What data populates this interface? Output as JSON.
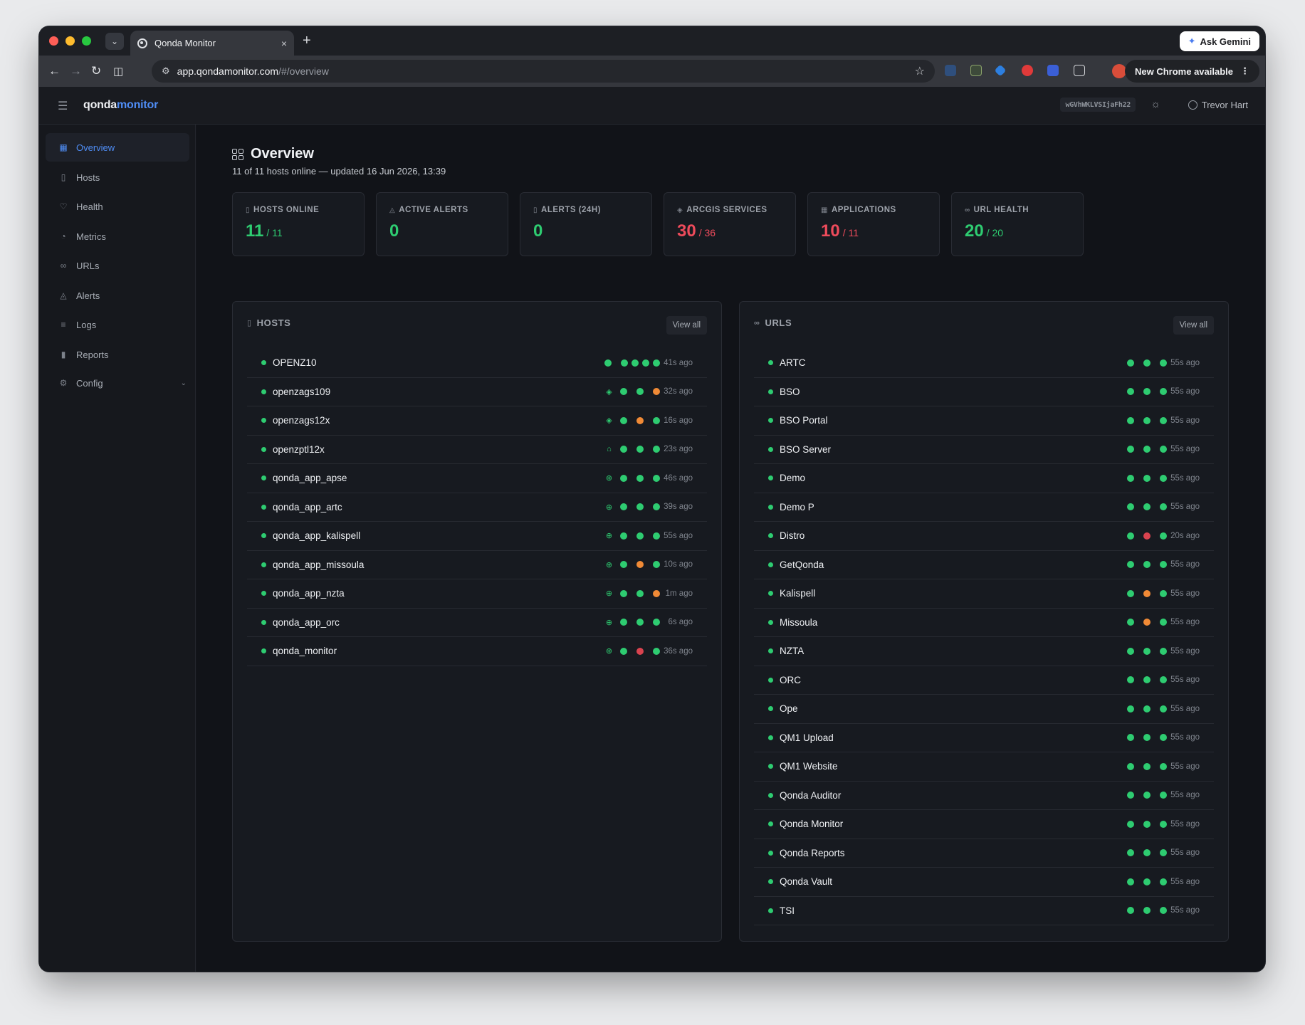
{
  "browser": {
    "tab_title": "Qonda Monitor",
    "tab_close": "×",
    "new_tab": "+",
    "url_host": "app.qondamonitor.com",
    "url_path": "/#/overview",
    "ask_gemini": "Ask Gemini",
    "new_chrome": "New Chrome available"
  },
  "app": {
    "brand_a": "qonda",
    "brand_b": "monitor",
    "token": "wGVhWKLVSIjaFh22",
    "user": "Trevor Hart"
  },
  "sidebar": {
    "items": [
      {
        "label": "Overview",
        "icon": "grid-icon",
        "active": true
      },
      {
        "label": "Hosts",
        "icon": "server-icon"
      },
      {
        "label": "Health",
        "icon": "heart-icon"
      },
      {
        "label": "Metrics",
        "icon": "gauge-icon"
      },
      {
        "label": "URLs",
        "icon": "link-icon"
      },
      {
        "label": "Alerts",
        "icon": "bell-icon"
      },
      {
        "label": "Logs",
        "icon": "list-icon"
      },
      {
        "label": "Reports",
        "icon": "bar-chart-icon"
      },
      {
        "label": "Config",
        "icon": "gear-icon"
      }
    ]
  },
  "page": {
    "title": "Overview",
    "subtitle": "11 of 11 hosts online — updated 16 Jun 2026, 13:39"
  },
  "stats": [
    {
      "label": "Hosts Online",
      "value": "11",
      "total": "/ 11",
      "color": "#2ecc71"
    },
    {
      "label": "Active Alerts",
      "value": "0",
      "total": "",
      "color": "#2ecc71"
    },
    {
      "label": "Alerts (24h)",
      "value": "0",
      "total": "",
      "color": "#2ecc71"
    },
    {
      "label": "ArcGIS Services",
      "value": "30",
      "total": "/ 36",
      "color": "#ee4b5b"
    },
    {
      "label": "Applications",
      "value": "10",
      "total": "/ 11",
      "color": "#ee4b5b"
    },
    {
      "label": "URL Health",
      "value": "20",
      "total": "/ 20",
      "color": "#2ecc71"
    }
  ],
  "hosts": {
    "title": "HOSTS",
    "view_all": "View all",
    "rows": [
      {
        "name": "OPENZ10",
        "type": "none",
        "dots": [
          "g",
          "g",
          "g",
          "g",
          "g"
        ],
        "age": "41s ago"
      },
      {
        "name": "openzags109",
        "type": "layers",
        "dots": [
          "g",
          "g",
          "o"
        ],
        "age": "32s ago"
      },
      {
        "name": "openzags12x",
        "type": "layers",
        "dots": [
          "g",
          "o",
          "g"
        ],
        "age": "16s ago"
      },
      {
        "name": "openzptl12x",
        "type": "home",
        "dots": [
          "g",
          "g",
          "g"
        ],
        "age": "23s ago"
      },
      {
        "name": "qonda_app_apse",
        "type": "globe",
        "dots": [
          "g",
          "g",
          "g"
        ],
        "age": "46s ago"
      },
      {
        "name": "qonda_app_artc",
        "type": "globe",
        "dots": [
          "g",
          "g",
          "g"
        ],
        "age": "39s ago"
      },
      {
        "name": "qonda_app_kalispell",
        "type": "globe",
        "dots": [
          "g",
          "g",
          "g"
        ],
        "age": "55s ago"
      },
      {
        "name": "qonda_app_missoula",
        "type": "globe",
        "dots": [
          "g",
          "o",
          "g"
        ],
        "age": "10s ago"
      },
      {
        "name": "qonda_app_nzta",
        "type": "globe",
        "dots": [
          "g",
          "g",
          "o"
        ],
        "age": "1m ago"
      },
      {
        "name": "qonda_app_orc",
        "type": "globe",
        "dots": [
          "g",
          "g",
          "g"
        ],
        "age": "6s ago"
      },
      {
        "name": "qonda_monitor",
        "type": "globe",
        "dots": [
          "g",
          "r",
          "g"
        ],
        "age": "36s ago"
      }
    ]
  },
  "urls": {
    "title": "URLS",
    "view_all": "View all",
    "rows": [
      {
        "name": "ARTC",
        "dots": [
          "g",
          "g",
          "g"
        ],
        "age": "55s ago"
      },
      {
        "name": "BSO",
        "dots": [
          "g",
          "g",
          "g"
        ],
        "age": "55s ago"
      },
      {
        "name": "BSO Portal",
        "dots": [
          "g",
          "g",
          "g"
        ],
        "age": "55s ago"
      },
      {
        "name": "BSO Server",
        "dots": [
          "g",
          "g",
          "g"
        ],
        "age": "55s ago"
      },
      {
        "name": "Demo",
        "dots": [
          "g",
          "g",
          "g"
        ],
        "age": "55s ago"
      },
      {
        "name": "Demo P",
        "dots": [
          "g",
          "g",
          "g"
        ],
        "age": "55s ago"
      },
      {
        "name": "Distro",
        "dots": [
          "g",
          "r",
          "g"
        ],
        "age": "20s ago"
      },
      {
        "name": "GetQonda",
        "dots": [
          "g",
          "g",
          "g"
        ],
        "age": "55s ago"
      },
      {
        "name": "Kalispell",
        "dots": [
          "g",
          "o",
          "g"
        ],
        "age": "55s ago"
      },
      {
        "name": "Missoula",
        "dots": [
          "g",
          "o",
          "g"
        ],
        "age": "55s ago"
      },
      {
        "name": "NZTA",
        "dots": [
          "g",
          "g",
          "g"
        ],
        "age": "55s ago"
      },
      {
        "name": "ORC",
        "dots": [
          "g",
          "g",
          "g"
        ],
        "age": "55s ago"
      },
      {
        "name": "Ope",
        "dots": [
          "g",
          "g",
          "g"
        ],
        "age": "55s ago"
      },
      {
        "name": "QM1 Upload",
        "dots": [
          "g",
          "g",
          "g"
        ],
        "age": "55s ago"
      },
      {
        "name": "QM1 Website",
        "dots": [
          "g",
          "g",
          "g"
        ],
        "age": "55s ago"
      },
      {
        "name": "Qonda Auditor",
        "dots": [
          "g",
          "g",
          "g"
        ],
        "age": "55s ago"
      },
      {
        "name": "Qonda Monitor",
        "dots": [
          "g",
          "g",
          "g"
        ],
        "age": "55s ago"
      },
      {
        "name": "Qonda Reports",
        "dots": [
          "g",
          "g",
          "g"
        ],
        "age": "55s ago"
      },
      {
        "name": "Qonda Vault",
        "dots": [
          "g",
          "g",
          "g"
        ],
        "age": "55s ago"
      },
      {
        "name": "TSI",
        "dots": [
          "g",
          "g",
          "g"
        ],
        "age": "55s ago"
      }
    ]
  }
}
